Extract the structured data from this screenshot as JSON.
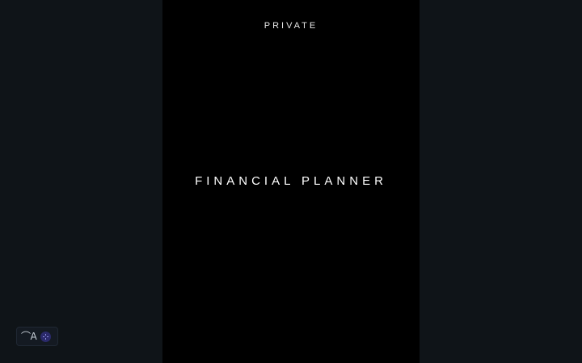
{
  "page": {
    "private_label": "PRIVATE",
    "title": "FINANCIAL PLANNER"
  },
  "badge": {
    "logo_text": "⌒A",
    "icon": "assistant-icon"
  },
  "colors": {
    "viewer_background": "#0f1418",
    "page_background": "#000000",
    "text": "#ffffff",
    "badge_accent": "#2b2a6b"
  }
}
